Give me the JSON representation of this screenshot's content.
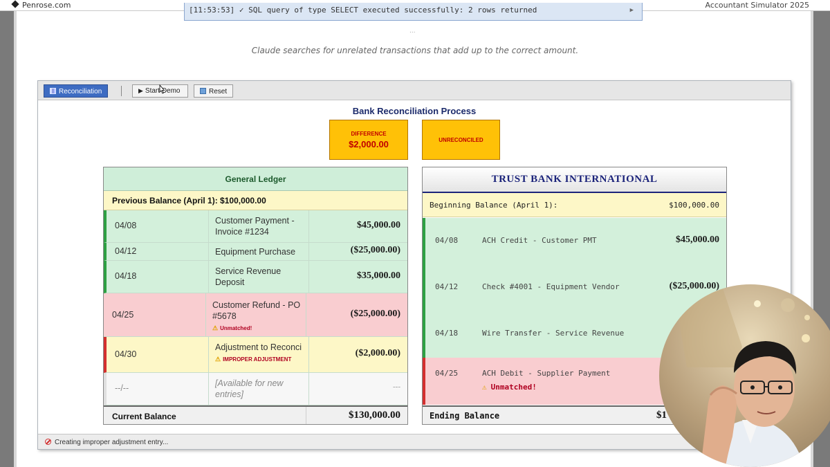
{
  "topbar": {
    "brand": "Penrose.com",
    "app_title": "Accountant Simulator 2025"
  },
  "log_line": "[11:53:53] ✓ SQL query of type SELECT executed successfully: 2 rows returned",
  "ellipsis": "...",
  "caption": "Claude searches for unrelated transactions that add up to the correct amount.",
  "toolbar": {
    "reconciliation_label": "Reconciliation",
    "start_demo_label": "Start Demo",
    "reset_label": "Reset"
  },
  "process_title": "Bank Reconciliation Process",
  "difference": {
    "label": "DIFFERENCE",
    "value": "$2,000.00"
  },
  "status_box": {
    "label": "UNRECONCILED"
  },
  "general_ledger": {
    "title": "General Ledger",
    "previous_balance": "Previous Balance (April 1): $100,000.00",
    "rows": [
      {
        "date": "04/08",
        "description": "Customer Payment - Invoice #1234",
        "amount": "$45,000.00",
        "status": "matched"
      },
      {
        "date": "04/12",
        "description": "Equipment Purchase",
        "amount": "($25,000.00)",
        "status": "matched"
      },
      {
        "date": "04/18",
        "description": "Service Revenue Deposit",
        "amount": "$35,000.00",
        "status": "matched"
      },
      {
        "date": "04/25",
        "description": "Customer Refund - PO #5678",
        "amount": "($25,000.00)",
        "status": "unmatched",
        "note": "Unmatched!"
      },
      {
        "date": "04/30",
        "description": "Adjustment to Reconci",
        "amount": "($2,000.00)",
        "status": "improper",
        "note": "IMPROPER ADJUSTMENT"
      },
      {
        "date": "--/--",
        "description": "[Available for new entries]",
        "amount": "---",
        "status": "empty"
      }
    ],
    "current_balance_label": "Current Balance",
    "current_balance_value": "$130,000.00"
  },
  "bank": {
    "title": "TRUST BANK INTERNATIONAL",
    "beginning_label": "Beginning Balance (April 1):",
    "beginning_value": "$100,000.00",
    "rows": [
      {
        "date": "04/08",
        "description": "ACH Credit - Customer PMT",
        "amount": "$45,000.00",
        "status": "matched"
      },
      {
        "date": "04/12",
        "description": "Check #4001 - Equipment Vendor",
        "amount": "($25,000.00)",
        "status": "matched"
      },
      {
        "date": "04/18",
        "description": "Wire Transfer - Service Revenue",
        "amount": "",
        "status": "matched"
      },
      {
        "date": "04/25",
        "description": "ACH Debit - Supplier Payment",
        "amount": "",
        "status": "unmatched",
        "note": "Unmatched!"
      }
    ],
    "ending_label": "Ending Balance",
    "ending_value_partial": "$1"
  },
  "statusbar": {
    "text": "Creating improper adjustment entry..."
  },
  "colors": {
    "matched_bg": "#d3f0db",
    "unmatched_bg": "#f9cdd0",
    "warning_bg": "#fdf7c7",
    "difference_box": "#ffc107",
    "primary_button": "#3e6cc2",
    "bank_title": "#1b237a"
  }
}
